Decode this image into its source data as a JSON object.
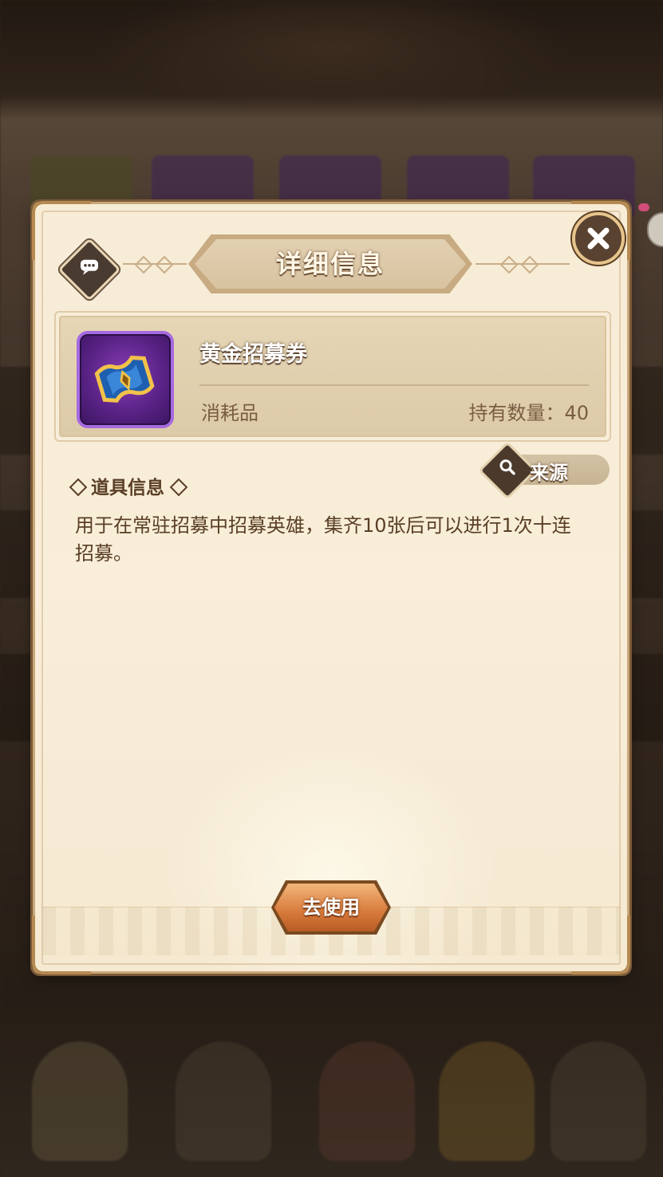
{
  "dialog": {
    "title": "详细信息",
    "close_icon": "close-icon",
    "chat_icon": "chat-bubble-icon"
  },
  "item": {
    "name": "黄金招募券",
    "type": "消耗品",
    "quantity_text": "持有数量：40",
    "quantity": 40,
    "icon": "golden-recruit-ticket-icon"
  },
  "source_button": {
    "label": "来源",
    "icon": "search-icon"
  },
  "section": {
    "title": "道具信息"
  },
  "description": "用于在常驻招募中招募英雄，集齐10张后可以进行1次十连招募。",
  "use_button": {
    "label": "去使用"
  },
  "colors": {
    "parchment": "#f7ecd6",
    "frame_gold": "#c9a77a",
    "text_brown": "#5a3e26",
    "button_orange": "#d77a3b",
    "icon_purple": "#5a2387"
  }
}
